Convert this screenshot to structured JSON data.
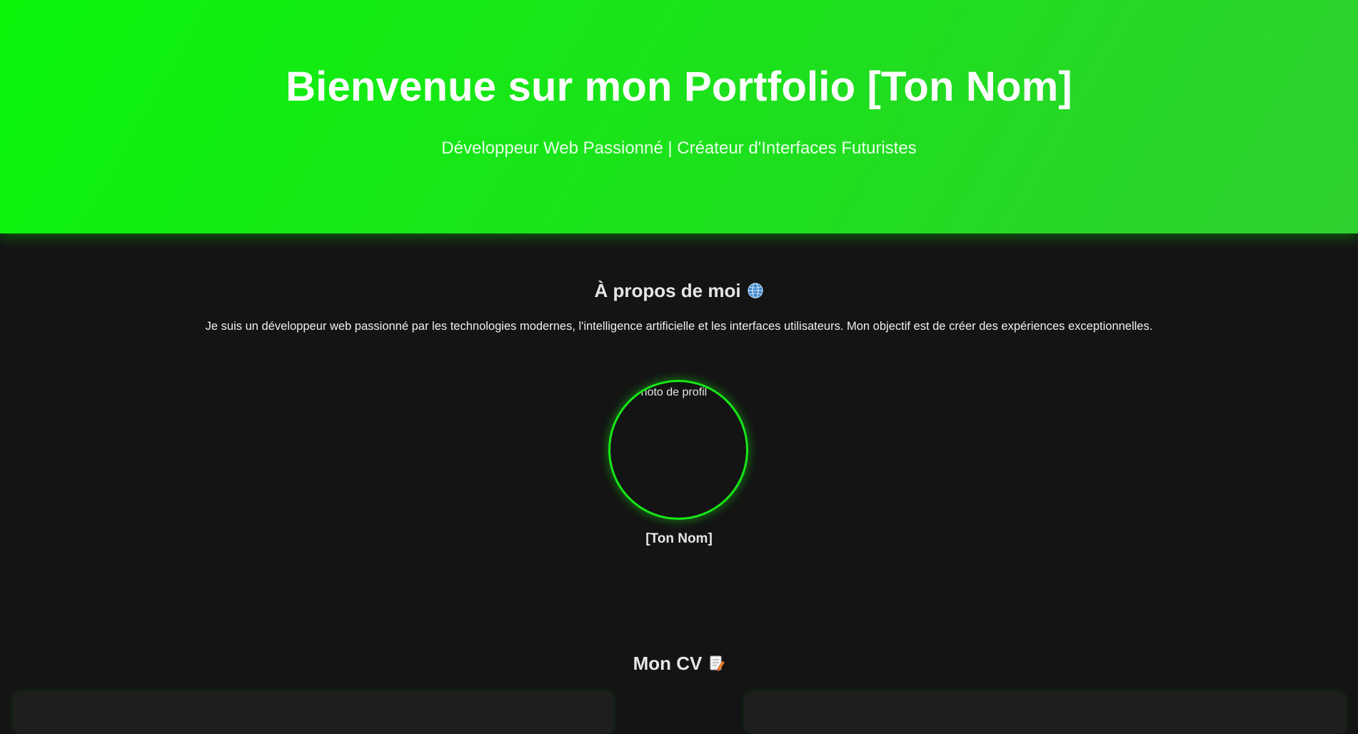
{
  "hero": {
    "title": "Bienvenue sur mon Portfolio [Ton Nom]",
    "subtitle": "Développeur Web Passionné | Créateur d'Interfaces Futuristes"
  },
  "about": {
    "title": "À propos de moi",
    "title_icon": "globe-icon",
    "text": "Je suis un développeur web passionné par les technologies modernes, l'intelligence artificielle et les interfaces utilisateurs. Mon objectif est de créer des expériences exceptionnelles.",
    "photo_alt": "Photo de profil",
    "name": "[Ton Nom]"
  },
  "cv": {
    "title": "Mon CV",
    "title_icon": "memo-icon"
  },
  "colors": {
    "accent": "#17e817",
    "hero_gradient_start": "#0af50a",
    "hero_gradient_end": "#2ed12e",
    "background": "#141414",
    "card_background": "#1e1e1e"
  }
}
